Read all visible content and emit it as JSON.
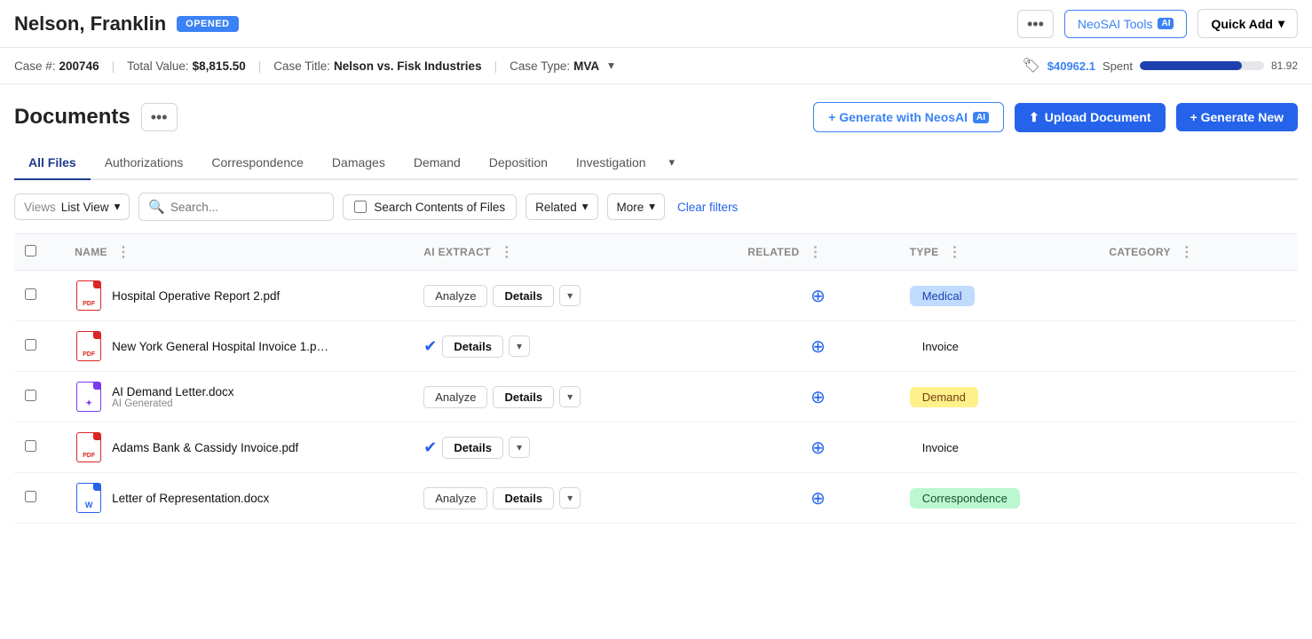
{
  "header": {
    "case_name": "Nelson, Franklin",
    "status": "OPENED",
    "case_number_label": "Case #:",
    "case_number": "200746",
    "total_value_label": "Total Value:",
    "total_value": "$8,815.50",
    "case_title_label": "Case Title:",
    "case_title": "Nelson vs. Fisk Industries",
    "case_type_label": "Case Type:",
    "case_type": "MVA",
    "budget_spent": "$40962.1",
    "budget_spent_label": "Spent",
    "budget_progress": 81.92,
    "budget_progress_pct": "81.92",
    "dots_btn": "•••",
    "neosai_tools_label": "NeoSAI Tools",
    "ai_badge": "AI",
    "quick_add_label": "Quick Add"
  },
  "documents": {
    "title": "Documents",
    "dots_btn": "•••",
    "generate_btn": "+ Generate with NeosAI",
    "upload_btn": "Upload Document",
    "generate_new_btn": "+ Generate New"
  },
  "tabs": [
    {
      "id": "all-files",
      "label": "All Files",
      "active": true
    },
    {
      "id": "authorizations",
      "label": "Authorizations",
      "active": false
    },
    {
      "id": "correspondence",
      "label": "Correspondence",
      "active": false
    },
    {
      "id": "damages",
      "label": "Damages",
      "active": false
    },
    {
      "id": "demand",
      "label": "Demand",
      "active": false
    },
    {
      "id": "deposition",
      "label": "Deposition",
      "active": false
    },
    {
      "id": "investigation",
      "label": "Investigation",
      "active": false
    }
  ],
  "filters": {
    "views_label": "Views",
    "list_view_label": "List View",
    "search_placeholder": "Search...",
    "search_contents_label": "Search Contents of Files",
    "related_label": "Related",
    "more_label": "More",
    "clear_filters_label": "Clear filters"
  },
  "table": {
    "headers": [
      {
        "id": "name",
        "label": "NAME"
      },
      {
        "id": "ai_extract",
        "label": "AI EXTRACT"
      },
      {
        "id": "related",
        "label": "RELATED"
      },
      {
        "id": "type",
        "label": "TYPE"
      },
      {
        "id": "category",
        "label": "CATEGORY"
      }
    ],
    "rows": [
      {
        "id": 1,
        "file_type": "pdf",
        "name": "Hospital Operative Report 2.pdf",
        "sub_label": "",
        "ai_action": "analyze",
        "ai_analyzed": false,
        "type_badge": "Medical",
        "type_badge_class": "type-medical",
        "category": ""
      },
      {
        "id": 2,
        "file_type": "pdf",
        "name": "New York General Hospital Invoice 1.p…",
        "sub_label": "",
        "ai_action": "details",
        "ai_analyzed": true,
        "type_badge": "Invoice",
        "type_badge_class": "type-invoice",
        "category": ""
      },
      {
        "id": 3,
        "file_type": "ai-docx",
        "name": "AI Demand Letter.docx",
        "sub_label": "AI Generated",
        "ai_action": "analyze",
        "ai_analyzed": false,
        "type_badge": "Demand",
        "type_badge_class": "type-demand",
        "category": ""
      },
      {
        "id": 4,
        "file_type": "pdf",
        "name": "Adams Bank & Cassidy Invoice.pdf",
        "sub_label": "",
        "ai_action": "details",
        "ai_analyzed": true,
        "type_badge": "Invoice",
        "type_badge_class": "type-invoice",
        "category": ""
      },
      {
        "id": 5,
        "file_type": "docx",
        "name": "Letter of Representation.docx",
        "sub_label": "",
        "ai_action": "analyze",
        "ai_analyzed": false,
        "type_badge": "Correspondence",
        "type_badge_class": "type-correspondence",
        "category": ""
      }
    ]
  }
}
